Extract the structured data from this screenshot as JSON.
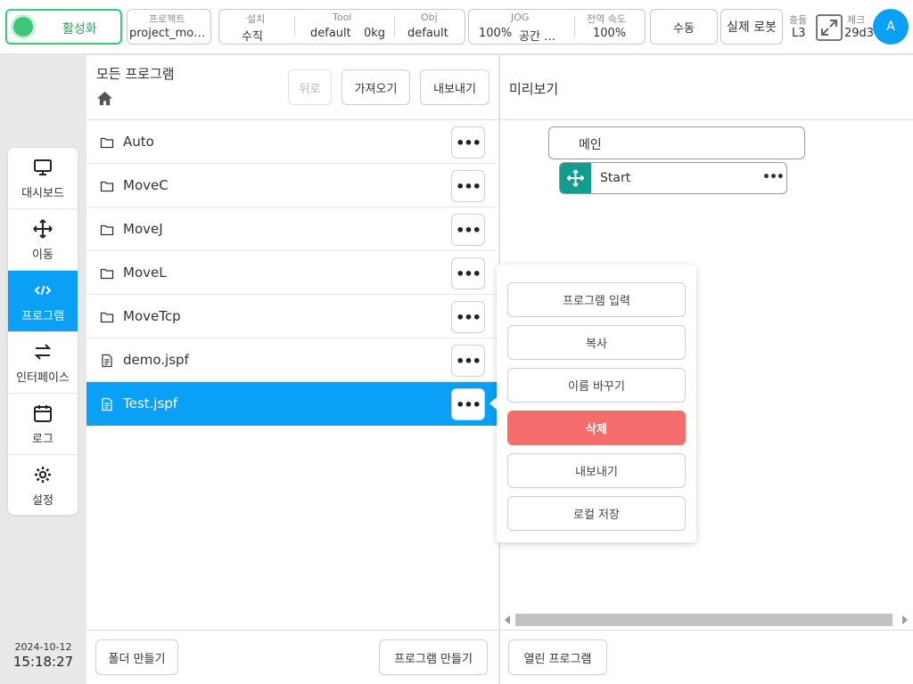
{
  "topbar": {
    "activate_label": "활성화",
    "project_label": "프로젝트",
    "project_value": "project_mo…",
    "install_label": "설치",
    "install_value": "수직",
    "tool_label": "Tool",
    "tool_value": "default",
    "tool_load": "0kg",
    "obj_label": "Obj",
    "obj_value": "default",
    "jog_label": "JOG",
    "jog_value": "100%",
    "jog_space": "공간 …",
    "speed_label": "전역 속도",
    "speed_value": "100%",
    "manual_label": "수동",
    "real_robot_label": "실제 로봇",
    "collision_label": "충돌",
    "collision_value": "L3",
    "check_label": "체크",
    "check_value": "29d3",
    "avatar_letter": "A",
    "accent_color": "#0aa0f5",
    "status_color": "#3cc878"
  },
  "sidebar": {
    "items": [
      {
        "label": "대시보드",
        "icon": "monitor-icon"
      },
      {
        "label": "이동",
        "icon": "move-arrows-icon"
      },
      {
        "label": "프로그램",
        "icon": "code-icon"
      },
      {
        "label": "인터페이스",
        "icon": "swap-arrows-icon"
      },
      {
        "label": "로그",
        "icon": "calendar-icon"
      },
      {
        "label": "설정",
        "icon": "gear-icon"
      }
    ],
    "active_index": 2,
    "date": "2024-10-12",
    "time": "15:18:27"
  },
  "file_panel": {
    "title": "모든 프로그램",
    "back_label": "뒤로",
    "import_label": "가져오기",
    "export_label": "내보내기",
    "files": [
      {
        "name": "Auto",
        "type": "folder"
      },
      {
        "name": "MoveC",
        "type": "folder"
      },
      {
        "name": "MoveJ",
        "type": "folder"
      },
      {
        "name": "MoveL",
        "type": "folder"
      },
      {
        "name": "MoveTcp",
        "type": "folder"
      },
      {
        "name": "demo.jspf",
        "type": "file"
      },
      {
        "name": "Test.jspf",
        "type": "file"
      }
    ],
    "selected_index": 6,
    "more_label": "•••",
    "create_folder_label": "폴더 만들기",
    "create_program_label": "프로그램 만들기"
  },
  "context_menu": {
    "items": [
      "프로그램 입력",
      "복사",
      "이름 바꾸기",
      "삭제",
      "내보내기",
      "로컬 저장"
    ],
    "danger_index": 3,
    "danger_color": "#f56c6c"
  },
  "preview": {
    "title": "미리보기",
    "main_label": "메인",
    "start_label": "Start",
    "more_label": "•••",
    "open_program_label": "열린 프로그램",
    "node_color": "#129c8e"
  }
}
